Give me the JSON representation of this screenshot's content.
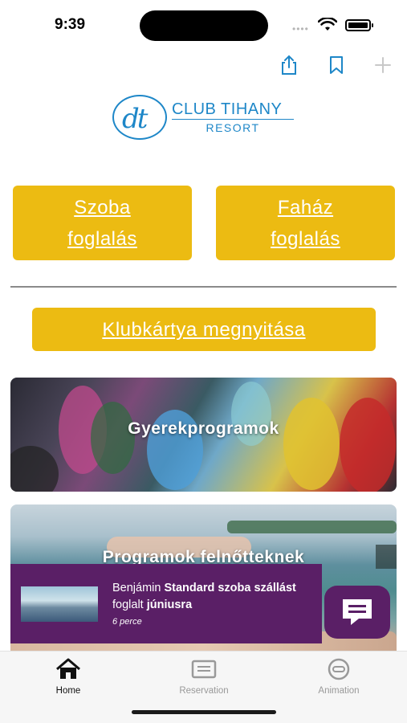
{
  "status_bar": {
    "time": "9:39",
    "dots": "••••"
  },
  "toolbar": {
    "icons": [
      "share-icon",
      "bookmark-icon",
      "plus-icon"
    ]
  },
  "logo": {
    "mark": "dt",
    "title": "CLUB TIHANY",
    "subtitle": "RESORT",
    "color": "#1e87c8"
  },
  "buttons": {
    "room": {
      "line1": "Szoba",
      "line2": "foglalás"
    },
    "cottage": {
      "line1": "Faház",
      "line2": "foglalás"
    },
    "clubcard": "Klubkártya megnyitása",
    "accent": "#ecbb12"
  },
  "cards": [
    {
      "title": "Gyerekprogramok"
    },
    {
      "title": "Programok felnőtteknek"
    }
  ],
  "toast": {
    "name": "Benjámin",
    "room": "Standard szoba",
    "stay": "szállást",
    "verb": "foglalt",
    "month": "júniusra",
    "time": "6 perce",
    "color": "#5a1f66"
  },
  "tabbar": {
    "tabs": [
      {
        "label": "Home",
        "icon": "home-icon",
        "active": true
      },
      {
        "label": "Reservation",
        "icon": "reservation-icon",
        "active": false
      },
      {
        "label": "Animation",
        "icon": "animation-icon",
        "active": false
      }
    ]
  }
}
